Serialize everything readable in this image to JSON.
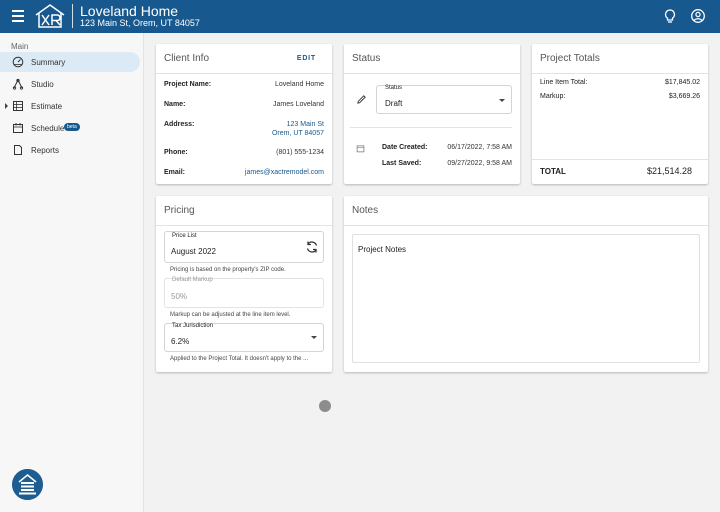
{
  "header": {
    "logo_text": "XR",
    "project_title": "Loveland Home",
    "project_address": "123 Main St, Orem, UT 84057",
    "icons": [
      "menu-icon",
      "lightbulb-icon",
      "account-circle-icon"
    ]
  },
  "sidebar": {
    "section_label": "Main",
    "items": [
      {
        "label": "Summary",
        "icon": "gauge-icon",
        "active": true
      },
      {
        "label": "Studio",
        "icon": "studio-icon"
      },
      {
        "label": "Estimate",
        "icon": "estimate-table-icon",
        "expandable": true
      },
      {
        "label": "Schedule",
        "icon": "calendar-icon",
        "badge": "beta"
      },
      {
        "label": "Reports",
        "icon": "document-icon"
      }
    ]
  },
  "client_info": {
    "title": "Client Info",
    "edit_label": "EDIT",
    "project_name_label": "Project Name:",
    "project_name": "Loveland Home",
    "name_label": "Name:",
    "name": "James Loveland",
    "address_label": "Address:",
    "address_line1": "123 Main St",
    "address_line2": "Orem, UT 84057",
    "phone_label": "Phone:",
    "phone": "(801) 555-1234",
    "email_label": "Email:",
    "email": "james@xactremodel.com"
  },
  "status": {
    "title": "Status",
    "field_label": "Status",
    "value": "Draft",
    "date_created_label": "Date Created:",
    "date_created": "06/17/2022, 7:58 AM",
    "last_saved_label": "Last Saved:",
    "last_saved": "09/27/2022, 9:58 AM"
  },
  "project_totals": {
    "title": "Project Totals",
    "line_item_total_label": "Line Item Total:",
    "line_item_total": "$17,845.02",
    "markup_label": "Markup:",
    "markup": "$3,669.26",
    "total_label": "TOTAL",
    "total": "$21,514.28"
  },
  "pricing": {
    "title": "Pricing",
    "price_list_label": "Price List",
    "price_list_value": "August 2022",
    "price_list_hint": "Pricing is based on the property's ZIP code.",
    "default_markup_label": "Default Markup",
    "default_markup_value": "50%",
    "markup_hint": "Markup can be adjusted at the line item level.",
    "tax_label": "Tax Jurisdiction",
    "tax_value": "6.2%",
    "tax_hint": "Applied to the Project Total. It doesn't apply to the ..."
  },
  "notes": {
    "title": "Notes",
    "content": "Project Notes"
  },
  "colors": {
    "brand": "#17598f",
    "active_nav": "#dbeaf4",
    "background": "#f2f2f2"
  }
}
